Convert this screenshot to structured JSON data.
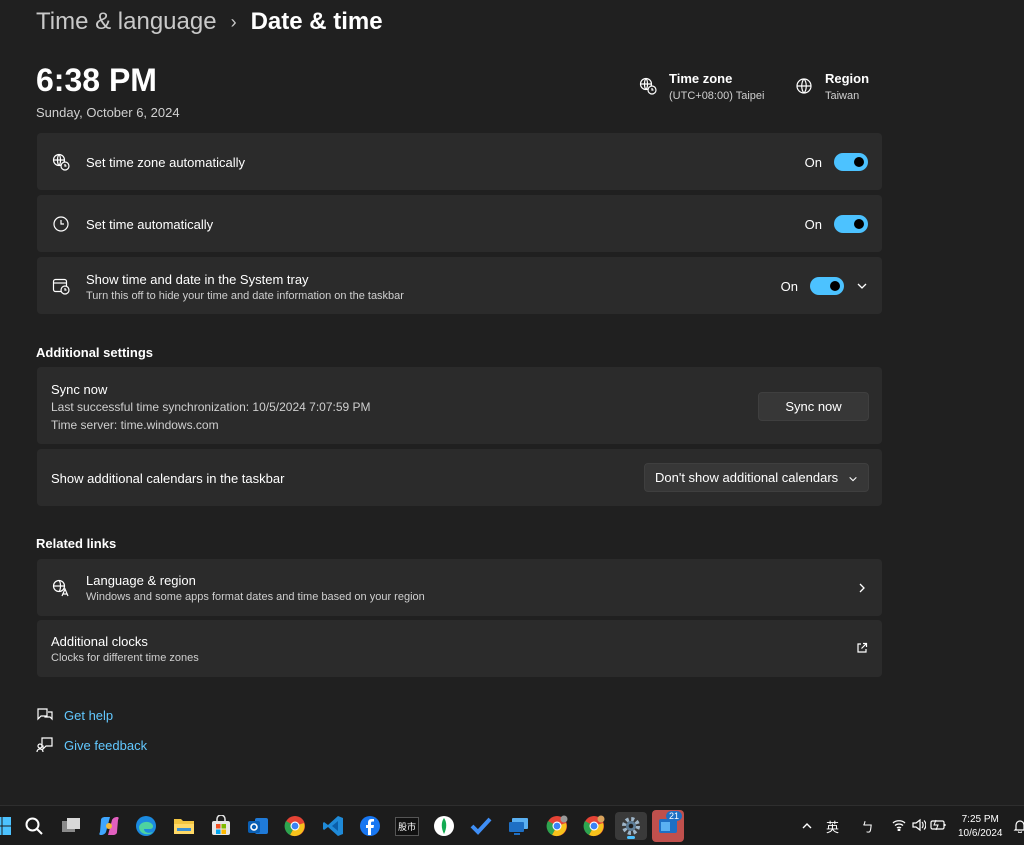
{
  "breadcrumb": {
    "parent": "Time & language",
    "separator": "›",
    "current": "Date & time"
  },
  "clock": {
    "time": "6:38 PM",
    "date": "Sunday, October 6, 2024"
  },
  "summary": {
    "time_zone": {
      "label": "Time zone",
      "value": "(UTC+08:00) Taipei",
      "icon": "clock-globe-icon"
    },
    "region": {
      "label": "Region",
      "value": "Taiwan",
      "icon": "globe-icon"
    }
  },
  "settings": {
    "tz_auto": {
      "label": "Set time zone automatically",
      "state": "On"
    },
    "time_auto": {
      "label": "Set time automatically",
      "state": "On"
    },
    "tray": {
      "label": "Show time and date in the System tray",
      "description": "Turn this off to hide your time and date information on the taskbar",
      "state": "On"
    }
  },
  "additional": {
    "title": "Additional settings",
    "sync": {
      "title": "Sync now",
      "last_sync": "Last successful time synchronization: 10/5/2024 7:07:59 PM",
      "server": "Time server: time.windows.com",
      "button": "Sync now"
    },
    "calendars": {
      "label": "Show additional calendars in the taskbar",
      "selected": "Don't show additional calendars"
    }
  },
  "related": {
    "title": "Related links",
    "language": {
      "title": "Language & region",
      "description": "Windows and some apps format dates and time based on your region"
    },
    "clocks": {
      "title": "Additional clocks",
      "description": "Clocks for different time zones"
    }
  },
  "help": {
    "get_help": "Get help",
    "feedback": "Give feedback"
  },
  "taskbar": {
    "tray_lang": "英",
    "tray_ime": "ㄅ",
    "clock_time": "7:25 PM",
    "clock_date": "10/6/2024",
    "badge_count": "21",
    "stock_label": "股市"
  },
  "colors": {
    "accent": "#4cc2ff",
    "background": "#202020",
    "card": "#2b2b2b",
    "link": "#62c8ff"
  }
}
